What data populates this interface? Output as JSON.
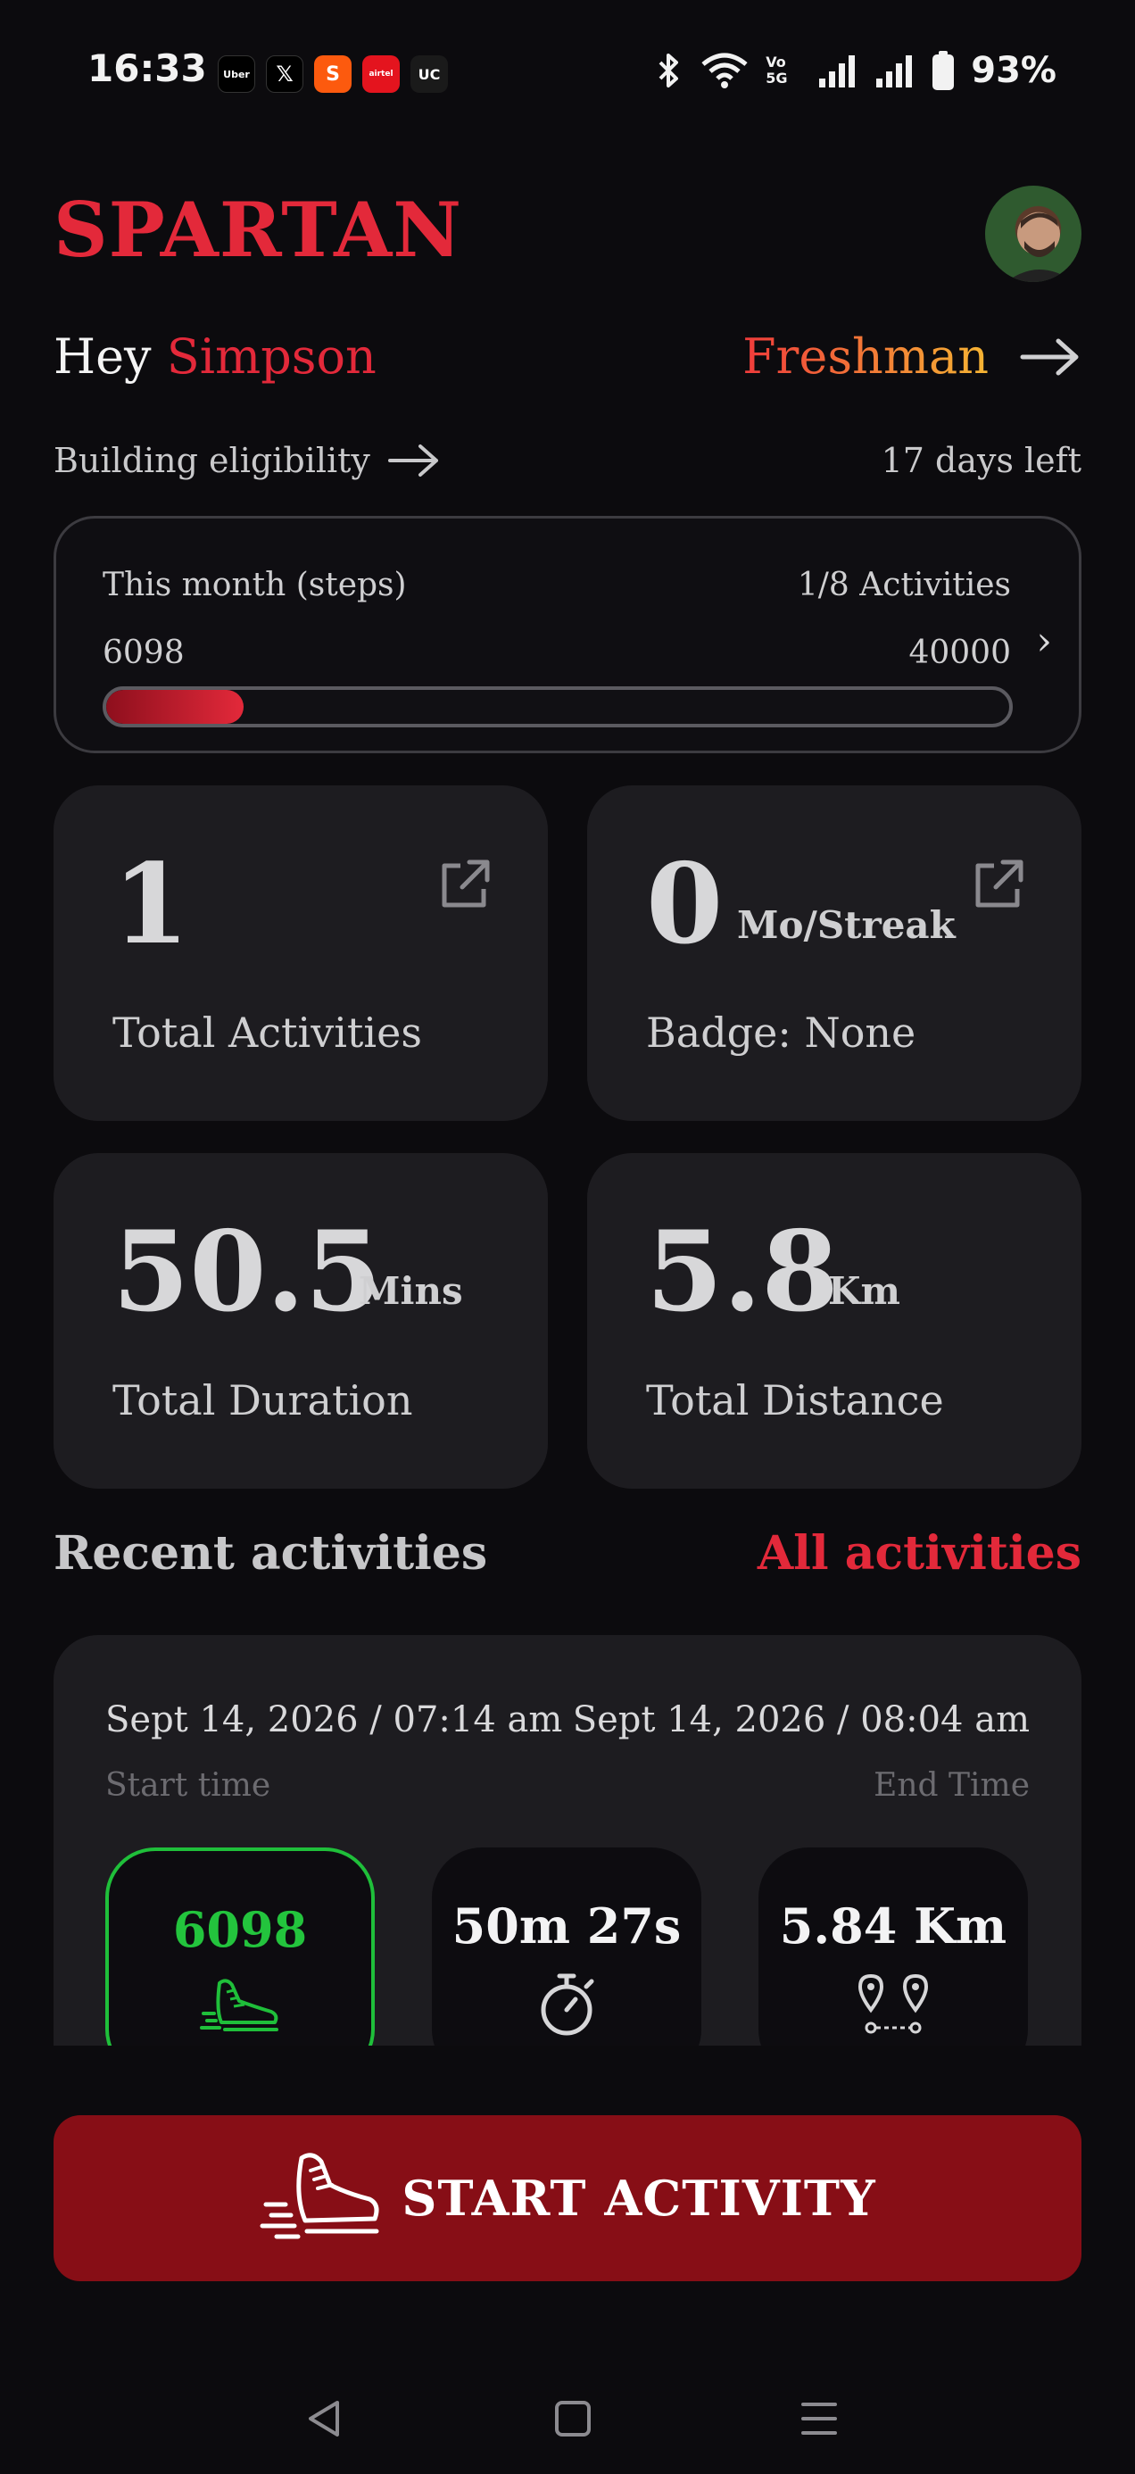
{
  "status_bar": {
    "time": "16:33",
    "apps": [
      {
        "name": "uber",
        "label": "Uber",
        "bg": "#000000"
      },
      {
        "name": "x",
        "label": "𝕏",
        "bg": "#000000"
      },
      {
        "name": "swiggy",
        "label": "S",
        "bg": "#fc5a0e"
      },
      {
        "name": "airtel",
        "label": "airtel",
        "bg": "#e4141e"
      },
      {
        "name": "uc",
        "label": "UC",
        "bg": "#1a1a1a"
      }
    ],
    "network_label": "Vo 5G",
    "battery": "93%"
  },
  "header": {
    "brand": "SPARTAN",
    "greeting": "Hey",
    "user_name": "Simpson",
    "rank": "Freshman",
    "eligibility": "Building eligibility",
    "days_left": "17 days left"
  },
  "progress": {
    "title": "This month (steps)",
    "activities": "1/8 Activities",
    "current": "6098",
    "goal": "40000",
    "fraction": 0.1525
  },
  "stats": [
    {
      "value": "1",
      "unit": "",
      "label": "Total Activities",
      "external": true
    },
    {
      "value": "0",
      "unit": "Mo/Streak",
      "label": "Badge: None",
      "external": true
    },
    {
      "value": "50.5",
      "unit": "Mins",
      "label": "Total Duration",
      "external": false
    },
    {
      "value": "5.8",
      "unit": "Km",
      "label": "Total Distance",
      "external": false
    }
  ],
  "recent": {
    "title": "Recent activities",
    "all_link": "All activities",
    "start": "Sept 14, 2026 / 07:14 am",
    "start_label": "Start time",
    "end": "Sept 14, 2026 / 08:04 am",
    "end_label": "End Time",
    "pills": [
      {
        "value": "6098",
        "icon": "shoe-icon"
      },
      {
        "value": "50m 27s",
        "icon": "stopwatch-icon"
      },
      {
        "value": "5.84 Km",
        "icon": "route-pins-icon"
      }
    ]
  },
  "cta": {
    "label": "START ACTIVITY",
    "icon": "running-shoe-icon"
  },
  "colors": {
    "accent": "#e3293a",
    "button": "#870e16",
    "active": "#23c43d",
    "card": "#1d1c20",
    "background": "#0c0b0e"
  }
}
